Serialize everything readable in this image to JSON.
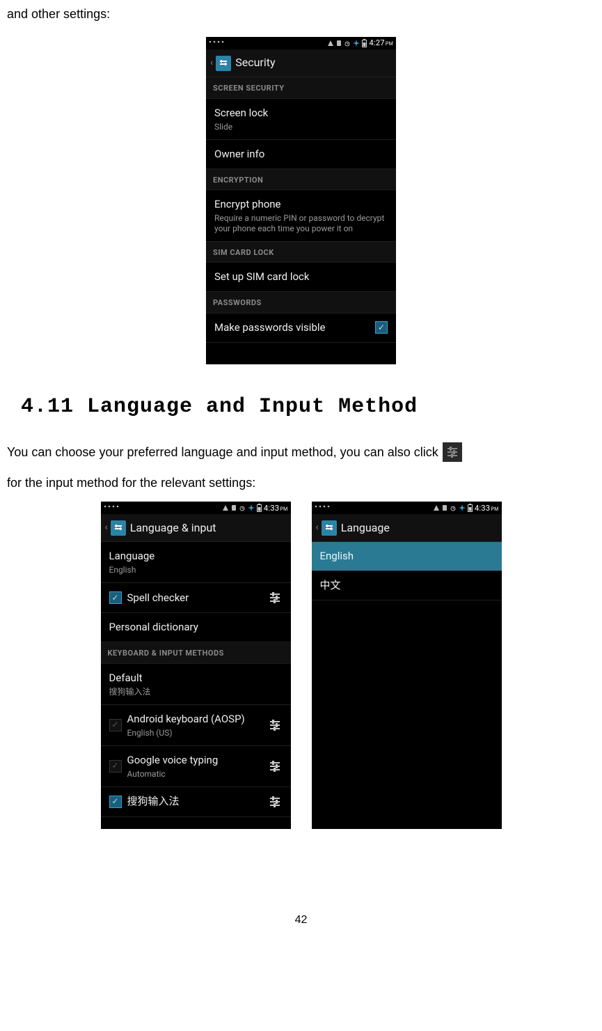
{
  "doc": {
    "intro_fragment": "and other settings:",
    "heading": "4.11 Language and Input Method",
    "para1": "You can choose your preferred language and input method, you can also click",
    "para2": "for the input method for the relevant settings:",
    "page_number": "42"
  },
  "phone_security": {
    "time": "4:27",
    "ampm": "PM",
    "title": "Security",
    "cat_screen": "SCREEN SECURITY",
    "row_screenlock": {
      "title": "Screen lock",
      "sub": "Slide"
    },
    "row_owner": {
      "title": "Owner info"
    },
    "cat_encryption": "ENCRYPTION",
    "row_encrypt": {
      "title": "Encrypt phone",
      "sub": "Require a numeric PIN or password to decrypt your phone each time you power it on"
    },
    "cat_sim": "SIM CARD LOCK",
    "row_sim": {
      "title": "Set up SIM card lock"
    },
    "cat_passwords": "PASSWORDS",
    "row_pwvisible": {
      "title": "Make passwords visible",
      "checked": true
    }
  },
  "phone_langinput": {
    "time": "4:33",
    "ampm": "PM",
    "title": "Language & input",
    "row_language": {
      "title": "Language",
      "sub": "English"
    },
    "row_spell": {
      "title": "Spell checker",
      "checked": true
    },
    "row_dict": {
      "title": "Personal dictionary"
    },
    "cat_keyb": "KEYBOARD & INPUT METHODS",
    "row_default": {
      "title": "Default",
      "sub": "搜狗输入法"
    },
    "row_aosp": {
      "title": "Android keyboard (AOSP)",
      "sub": "English (US)",
      "checked": true
    },
    "row_gvoice": {
      "title": "Google voice typing",
      "sub": "Automatic",
      "checked": true
    },
    "row_sogou": {
      "title": "搜狗输入法",
      "checked": true
    }
  },
  "phone_language": {
    "time": "4:33",
    "ampm": "PM",
    "title": "Language",
    "row_english": {
      "title": "English"
    },
    "row_chinese": {
      "title": "中文"
    }
  }
}
